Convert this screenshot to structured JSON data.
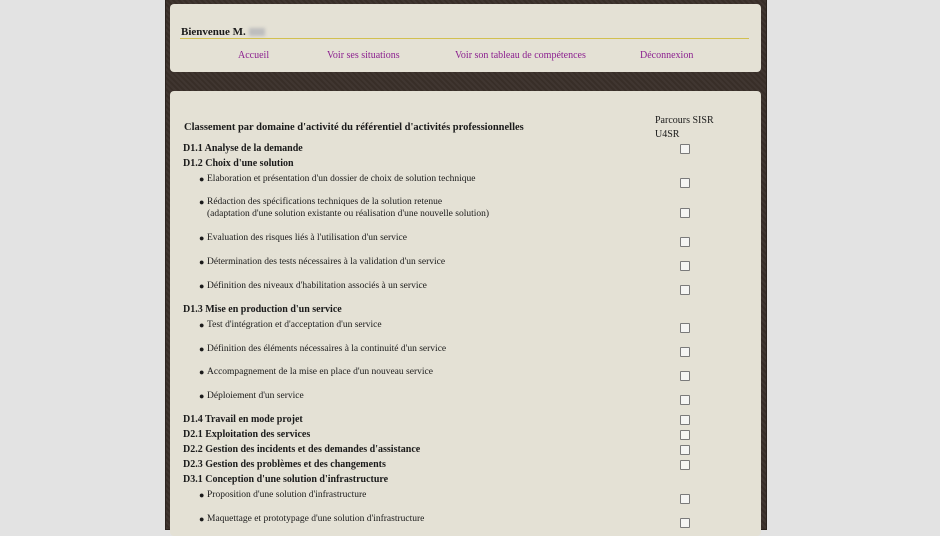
{
  "header": {
    "welcome": "Bienvenue M.",
    "nav": {
      "accueil": "Accueil",
      "situations": "Voir ses situations",
      "competences": "Voir son tableau de compétences",
      "deconnexion": "Déconnexion"
    }
  },
  "main": {
    "classement_title": "Classement par domaine d'activité du référentiel d'activités professionnelles",
    "parcours_line1": "Parcours SISR",
    "parcours_line2": "U4SR",
    "rows": [
      {
        "type": "domain",
        "label": "D1.1 Analyse de la demande"
      },
      {
        "type": "domain",
        "label": "D1.2 Choix d'une solution"
      },
      {
        "type": "item",
        "label": "Elaboration et présentation d'un dossier de choix de solution technique"
      },
      {
        "type": "item",
        "label": "Rédaction des spécifications techniques de la solution retenue",
        "label2": "(adaptation d'une solution existante ou réalisation d'une nouvelle solution)"
      },
      {
        "type": "item",
        "label": "Evaluation des risques liés à l'utilisation d'un service"
      },
      {
        "type": "item",
        "label": "Détermination des tests nécessaires à la validation d'un service"
      },
      {
        "type": "item",
        "label": "Définition des niveaux d'habilitation associés à un service"
      },
      {
        "type": "domain",
        "label": "D1.3 Mise en production d'un service"
      },
      {
        "type": "item",
        "label": "Test d'intégration et d'acceptation d'un service"
      },
      {
        "type": "item",
        "label": "Définition des éléments nécessaires à la continuité d'un service"
      },
      {
        "type": "item",
        "label": "Accompagnement de la mise en place d'un nouveau service"
      },
      {
        "type": "item",
        "label": "Déploiement d'un service"
      },
      {
        "type": "domain",
        "label": "D1.4 Travail en mode projet"
      },
      {
        "type": "domain",
        "label": "D2.1 Exploitation des services"
      },
      {
        "type": "domain",
        "label": "D2.2 Gestion des incidents et des demandes d'assistance"
      },
      {
        "type": "domain",
        "label": "D2.3 Gestion des problèmes et des changements"
      },
      {
        "type": "domain",
        "label": "D3.1 Conception d'une solution d'infrastructure"
      },
      {
        "type": "item",
        "label": "Proposition d'une solution d'infrastructure"
      },
      {
        "type": "item",
        "label": "Maquettage et prototypage d'une solution d'infrastructure"
      }
    ]
  }
}
